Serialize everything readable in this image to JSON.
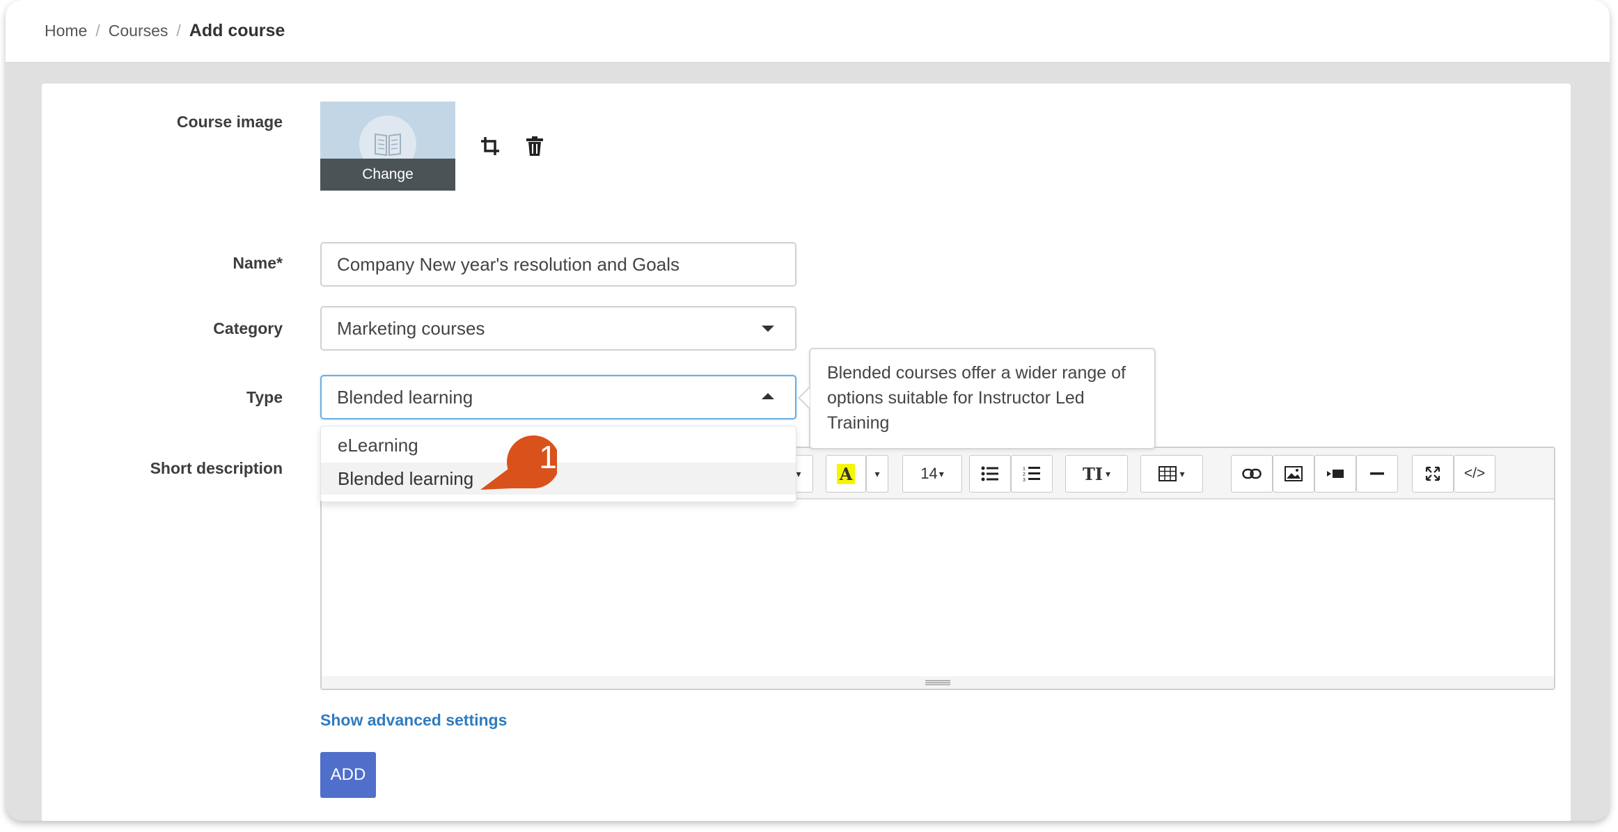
{
  "breadcrumb": {
    "items": [
      "Home",
      "Courses"
    ],
    "current": "Add course"
  },
  "form": {
    "course_image": {
      "label": "Course image",
      "change_label": "Change",
      "crop_icon": "crop-icon",
      "delete_icon": "trash-icon"
    },
    "name": {
      "label": "Name*",
      "value": "Company New year's resolution and Goals"
    },
    "category": {
      "label": "Category",
      "value": "Marketing courses"
    },
    "type": {
      "label": "Type",
      "value": "Blended learning",
      "options": [
        "eLearning",
        "Blended learning"
      ],
      "selected_option": "Blended learning",
      "tooltip": "Blended courses offer a wider range of options suitable for Instructor Led Training"
    },
    "short_description": {
      "label": "Short description",
      "toolbar": {
        "font_size": "14",
        "highlight_letter": "A",
        "text_style_label": "TI",
        "code_label": "</>"
      }
    },
    "advanced_link": "Show advanced settings",
    "add_button": "ADD"
  },
  "annotation": {
    "step_number": "1",
    "color": "#d9521c"
  },
  "colors": {
    "link": "#2f7bbf",
    "primary_button": "#4f6fcb",
    "focus_border": "#69aee4",
    "highlight_yellow": "#f5f500"
  }
}
